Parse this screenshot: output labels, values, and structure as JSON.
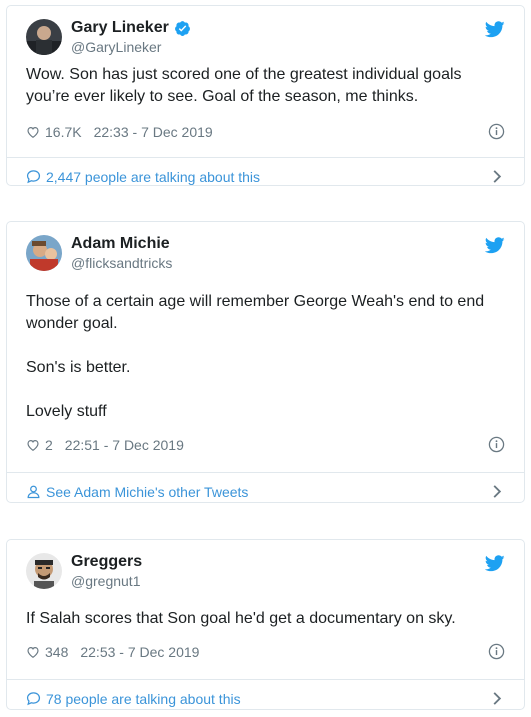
{
  "colors": {
    "accent": "#1da1f2",
    "link": "#3b94d9",
    "muted": "#697882",
    "border": "#e1e8ed"
  },
  "tweets": [
    {
      "name": "Gary Lineker",
      "handle": "@GaryLineker",
      "verified": true,
      "paragraphs": [
        "Wow. Son has just scored one of the greatest individual goals you’re ever likely to see. Goal of the season, me thinks."
      ],
      "likes": "16.7K",
      "timestamp": "22:33 - 7 Dec 2019",
      "footer": "2,447 people are talking about this",
      "footer_icon": "speech-bubble-icon"
    },
    {
      "name": "Adam Michie",
      "handle": "@flicksandtricks",
      "verified": false,
      "paragraphs": [
        "Those of a certain age will remember George Weah's end to end wonder goal.",
        "Son's is better.",
        "Lovely stuff"
      ],
      "likes": "2",
      "timestamp": "22:51 - 7 Dec 2019",
      "footer": "See Adam Michie's other Tweets",
      "footer_icon": "person-icon"
    },
    {
      "name": "Greggers",
      "handle": "@gregnut1",
      "verified": false,
      "paragraphs": [
        "If Salah scores that Son goal he'd get a documentary on sky."
      ],
      "likes": "348",
      "timestamp": "22:53 - 7 Dec 2019",
      "footer": "78 people are talking about this",
      "footer_icon": "speech-bubble-icon"
    }
  ]
}
